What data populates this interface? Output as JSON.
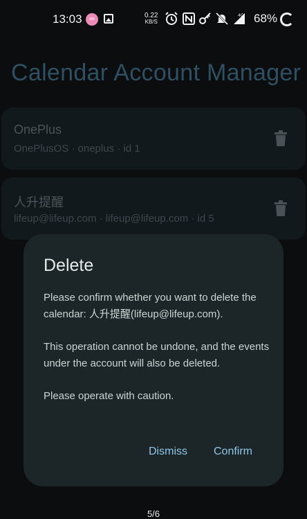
{
  "status_bar": {
    "time": "13:03",
    "net_speed_value": "0.22",
    "net_speed_unit": "KB/S",
    "battery": "68%",
    "icons": [
      "avatar-icon",
      "image-icon",
      "alarm-icon",
      "nfc-icon",
      "key-icon",
      "mute-icon",
      "signal-4g-icon",
      "battery-ring-icon"
    ]
  },
  "page": {
    "title": "Calendar Account Manager",
    "accounts": [
      {
        "name": "OnePlus",
        "detail": "OnePlusOS · oneplus · id 1"
      },
      {
        "name": "人升提醒",
        "detail": "lifeup@lifeup.com · lifeup@lifeup.com · id 5"
      }
    ]
  },
  "dialog": {
    "title": "Delete",
    "body": [
      "Please confirm whether you want to delete the calendar: 人升提醒(lifeup@lifeup.com).",
      "This operation cannot be undone, and the events under the account will also be deleted.",
      "Please operate with caution."
    ],
    "dismiss_label": "Dismiss",
    "confirm_label": "Confirm"
  },
  "pager": "5/6",
  "colors": {
    "background": "#0b0d0e",
    "dialog": "#1c2628",
    "accent": "#8fc6e9",
    "title_dim": "#2f4f63"
  }
}
